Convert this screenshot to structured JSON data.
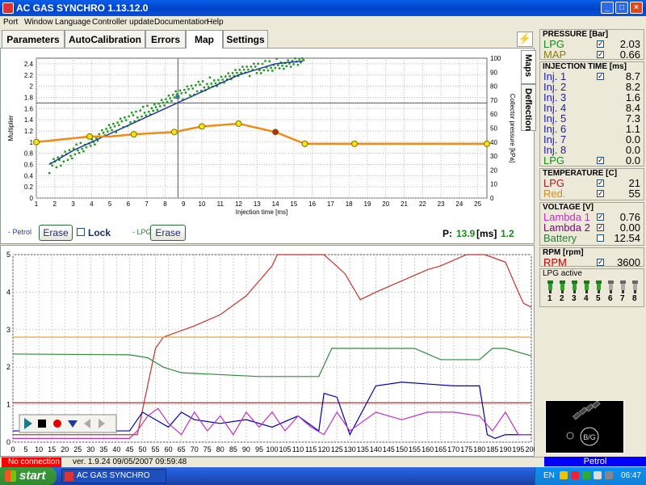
{
  "window": {
    "title": "AC GAS SYNCHRO    1.13.12.0"
  },
  "menu": [
    "Port",
    "Window",
    "Language",
    "Controller update",
    "Documentation",
    "Help"
  ],
  "tabs": [
    "Parameters",
    "AutoCalibration",
    "Errors",
    "Map",
    "Settings"
  ],
  "active_tab": "Map",
  "side_tabs": [
    "Maps",
    "Deflection"
  ],
  "map_panel": {
    "petrol_label": "- Petrol",
    "erase_label": "Erase",
    "lock_label": "Lock",
    "lpg_label": "- LPG",
    "erase2_label": "Erase",
    "p_label": "P:",
    "p_value": "13.9",
    "p_unit": "[ms]",
    "p_ratio": "1.2"
  },
  "chart_data": [
    {
      "type": "line",
      "title": "",
      "xlabel": "Injection time [ms]",
      "ylabel": "Multiplier",
      "y2label": "Collector pressure [kPa]",
      "xlim": [
        1,
        25.5
      ],
      "ylim": [
        0,
        2.5
      ],
      "y2lim": [
        0,
        100
      ],
      "x_ticks": [
        1,
        2,
        3,
        4,
        5,
        6,
        7,
        8,
        9,
        10,
        11,
        12,
        13,
        14,
        15,
        16,
        17,
        18,
        19,
        20,
        21,
        22,
        23,
        24,
        25
      ],
      "y_ticks": [
        0,
        0.2,
        0.4,
        0.6,
        0.8,
        1,
        1.2,
        1.4,
        1.6,
        1.8,
        2,
        2.2,
        2.4
      ],
      "y2_ticks": [
        0,
        10,
        20,
        30,
        40,
        50,
        60,
        70,
        80,
        90,
        100
      ],
      "cursor": {
        "x": 8.7,
        "y2": 68
      },
      "series": [
        {
          "role": "multiplier curve",
          "color": "#f08c14",
          "x": [
            1,
            3.9,
            5,
            6.3,
            8.5,
            10,
            12,
            14,
            15.6,
            18.3,
            25.5
          ],
          "y": [
            1.0,
            1.1,
            1.1,
            1.14,
            1.18,
            1.28,
            1.33,
            1.18,
            0.97,
            0.97,
            0.97
          ],
          "markers_x": [
            1,
            3.9,
            6.3,
            8.5,
            10,
            12,
            14,
            15.6,
            18.3,
            25.5
          ]
        },
        {
          "role": "pressure fit",
          "color": "#203a9c",
          "x": [
            1.7,
            3,
            4,
            5,
            6,
            7,
            8,
            9,
            10,
            11,
            12,
            13,
            14,
            15.5
          ],
          "y2": [
            24,
            34,
            40,
            46,
            52,
            58,
            64,
            70,
            76,
            82,
            88,
            92,
            96,
            98
          ]
        },
        {
          "role": "pressure samples",
          "color": "#1f9a1f",
          "x_range": [
            1.7,
            15.6
          ],
          "y2_range": [
            22,
            98
          ]
        }
      ]
    },
    {
      "type": "line",
      "title": "",
      "xlim": [
        0,
        200
      ],
      "ylim": [
        0,
        5
      ],
      "x_ticks": [
        0,
        5,
        10,
        15,
        20,
        25,
        30,
        35,
        40,
        45,
        50,
        55,
        60,
        65,
        70,
        75,
        80,
        85,
        90,
        95,
        100,
        105,
        110,
        115,
        120,
        125,
        130,
        135,
        140,
        145,
        150,
        155,
        160,
        165,
        170,
        175,
        180,
        185,
        190,
        195,
        200
      ],
      "y_ticks": [
        0,
        1,
        2,
        3,
        4,
        5
      ],
      "series": [
        {
          "role": "rpm",
          "color": "#c8322a",
          "x": [
            0,
            48,
            55,
            58,
            70,
            80,
            90,
            95,
            100,
            102,
            120,
            128,
            134,
            140,
            150,
            160,
            165,
            175,
            180,
            182,
            190,
            195,
            197,
            200
          ],
          "y": [
            0.2,
            0.2,
            2.5,
            2.8,
            3.1,
            3.4,
            3.9,
            4.3,
            4.7,
            5.0,
            5.0,
            4.5,
            3.8,
            4.0,
            4.3,
            4.6,
            4.7,
            5.0,
            5.0,
            5.0,
            4.8,
            4.0,
            3.7,
            3.6
          ]
        },
        {
          "role": "reference line",
          "color": "#e89626",
          "x": [
            0,
            200
          ],
          "y": [
            2.8,
            2.8
          ]
        },
        {
          "role": "reference line",
          "color": "#a03a3a",
          "x": [
            0,
            200
          ],
          "y": [
            1.05,
            1.05
          ]
        },
        {
          "role": "battery",
          "color": "#2f8a3a",
          "x": [
            0,
            45,
            52,
            58,
            65,
            95,
            118,
            123,
            135,
            155,
            165,
            180,
            185,
            190,
            200
          ],
          "y": [
            2.35,
            2.33,
            2.25,
            2.0,
            1.85,
            1.75,
            1.75,
            2.5,
            2.5,
            2.5,
            2.2,
            2.2,
            2.5,
            2.5,
            2.3
          ]
        },
        {
          "role": "injection",
          "color": "#0000aa",
          "x": [
            0,
            45,
            50,
            55,
            60,
            65,
            70,
            80,
            90,
            100,
            110,
            118,
            120,
            125,
            130,
            140,
            150,
            160,
            170,
            180,
            183,
            186,
            190,
            200
          ],
          "y": [
            0.3,
            0.3,
            0.8,
            0.6,
            0.4,
            0.8,
            0.6,
            0.5,
            0.6,
            0.4,
            0.7,
            0.3,
            1.3,
            1.2,
            0.2,
            1.5,
            1.6,
            1.55,
            1.5,
            1.5,
            0.2,
            0.1,
            0.2,
            0.2
          ]
        },
        {
          "role": "lambda",
          "color": "#c030c0",
          "x": [
            0,
            45,
            48,
            52,
            56,
            60,
            65,
            70,
            75,
            80,
            85,
            90,
            95,
            100,
            105,
            110,
            115,
            120,
            125,
            130,
            140,
            150,
            160,
            170,
            180,
            185,
            190,
            195,
            200
          ],
          "y": [
            0.1,
            0.1,
            0.3,
            0.7,
            0.9,
            0.5,
            0.2,
            0.8,
            0.3,
            0.7,
            0.2,
            0.8,
            0.4,
            0.8,
            0.3,
            0.7,
            0.4,
            0.2,
            0.8,
            0.3,
            0.8,
            0.6,
            0.8,
            0.8,
            0.7,
            0.3,
            0.8,
            0.2,
            0.2
          ]
        }
      ]
    }
  ],
  "pressure": {
    "header": "PRESSURE [Bar]",
    "rows": [
      {
        "label": "LPG",
        "value": "2.03",
        "color": "#1a8a1a"
      },
      {
        "label": "MAP",
        "value": "0.66",
        "color": "#8a7a10"
      }
    ]
  },
  "injection": {
    "header": "INJECTION TIME [ms]",
    "rows": [
      {
        "label": "Inj. 1",
        "value": "8.7"
      },
      {
        "label": "Inj. 2",
        "value": "8.2"
      },
      {
        "label": "Inj. 3",
        "value": "1.6"
      },
      {
        "label": "Inj. 4",
        "value": "8.4"
      },
      {
        "label": "Inj. 5",
        "value": "7.3"
      },
      {
        "label": "Inj. 6",
        "value": "1.1"
      },
      {
        "label": "Inj. 7",
        "value": "0.0"
      },
      {
        "label": "Inj. 8",
        "value": "0.0"
      }
    ],
    "lpg_label": "LPG",
    "lpg_value": "0.0"
  },
  "temperature": {
    "header": "TEMPERATURE  [C]",
    "rows": [
      {
        "label": "LPG",
        "value": "21",
        "color": "#a02020"
      },
      {
        "label": "Red.",
        "value": "55",
        "color": "#e08a10"
      }
    ]
  },
  "voltage": {
    "header": "VOLTAGE [V]",
    "rows": [
      {
        "label": "Lambda 1",
        "value": "0.76",
        "color": "#c030c0"
      },
      {
        "label": "Lambda 2",
        "value": "0.00",
        "color": "#800080"
      },
      {
        "label": "Battery",
        "value": "12.54",
        "color": "#2f7a3a"
      }
    ]
  },
  "rpm": {
    "header": "RPM [rpm]",
    "label": "RPM",
    "value": "3600",
    "color": "#c00000"
  },
  "lpg_active": {
    "header": "LPG active",
    "items": [
      "1",
      "2",
      "3",
      "4",
      "5",
      "6",
      "7",
      "8"
    ]
  },
  "mode": {
    "label": "Petrol"
  },
  "status": {
    "connection": "No connection",
    "version": "ver. 1.9.24   09/05/2007   09:59:48"
  },
  "switch_label": "B/G",
  "taskbar": {
    "start": "start",
    "app": "AC GAS SYNCHRO",
    "lang": "EN",
    "clock": "06:47"
  }
}
